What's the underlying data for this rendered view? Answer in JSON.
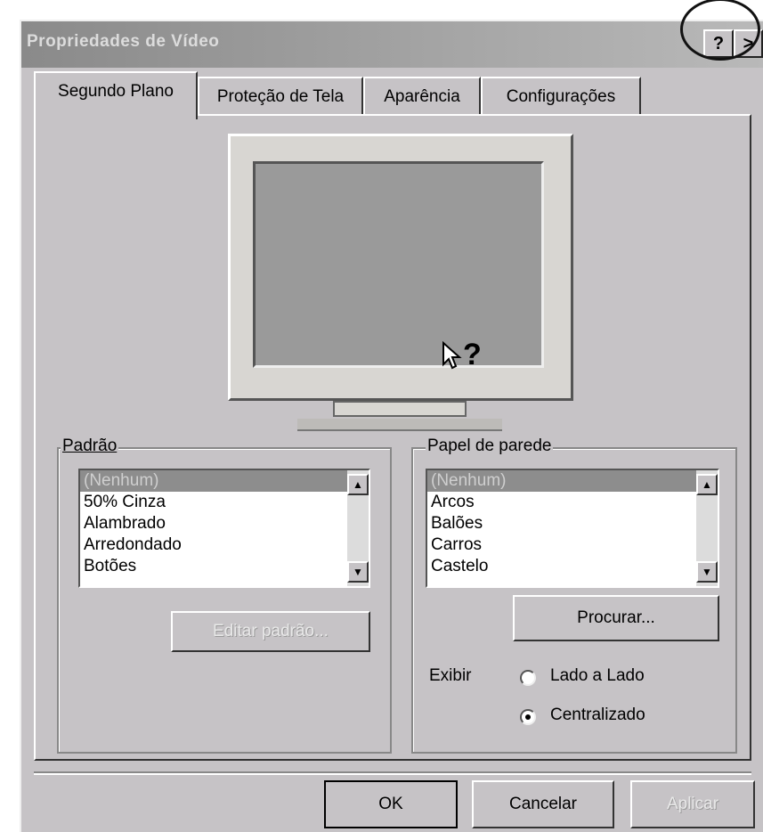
{
  "window": {
    "title": "Propriedades de Vídeo",
    "help_button": "?",
    "close_button_partial": ">"
  },
  "tabs": [
    {
      "label": "Segundo Plano",
      "active": true
    },
    {
      "label": "Proteção de Tela",
      "active": false
    },
    {
      "label": "Aparência",
      "active": false
    },
    {
      "label": "Configurações",
      "active": false
    }
  ],
  "preview": {
    "cursor_glyph": "?"
  },
  "pattern_group": {
    "label": "Padrão",
    "items": [
      "(Nenhum)",
      "50% Cinza",
      "Alambrado",
      "Arredondado",
      "Botões"
    ],
    "edit_button": "Editar padrão..."
  },
  "wallpaper_group": {
    "label": "Papel de parede",
    "items": [
      "(Nenhum)",
      "Arcos",
      "Balões",
      "Carros",
      "Castelo"
    ],
    "browse_button": "Procurar...",
    "display_label": "Exibir",
    "options": [
      {
        "label": "Lado a Lado",
        "checked": false
      },
      {
        "label": "Centralizado",
        "checked": true
      }
    ]
  },
  "footer": {
    "ok_label": "OK",
    "cancel_label": "Cancelar",
    "apply_label": "Aplicar"
  },
  "colors": {
    "dialog_bg": "#c6c3c6",
    "selection": "#8d8d8d",
    "screen": "#9a9a9a"
  }
}
